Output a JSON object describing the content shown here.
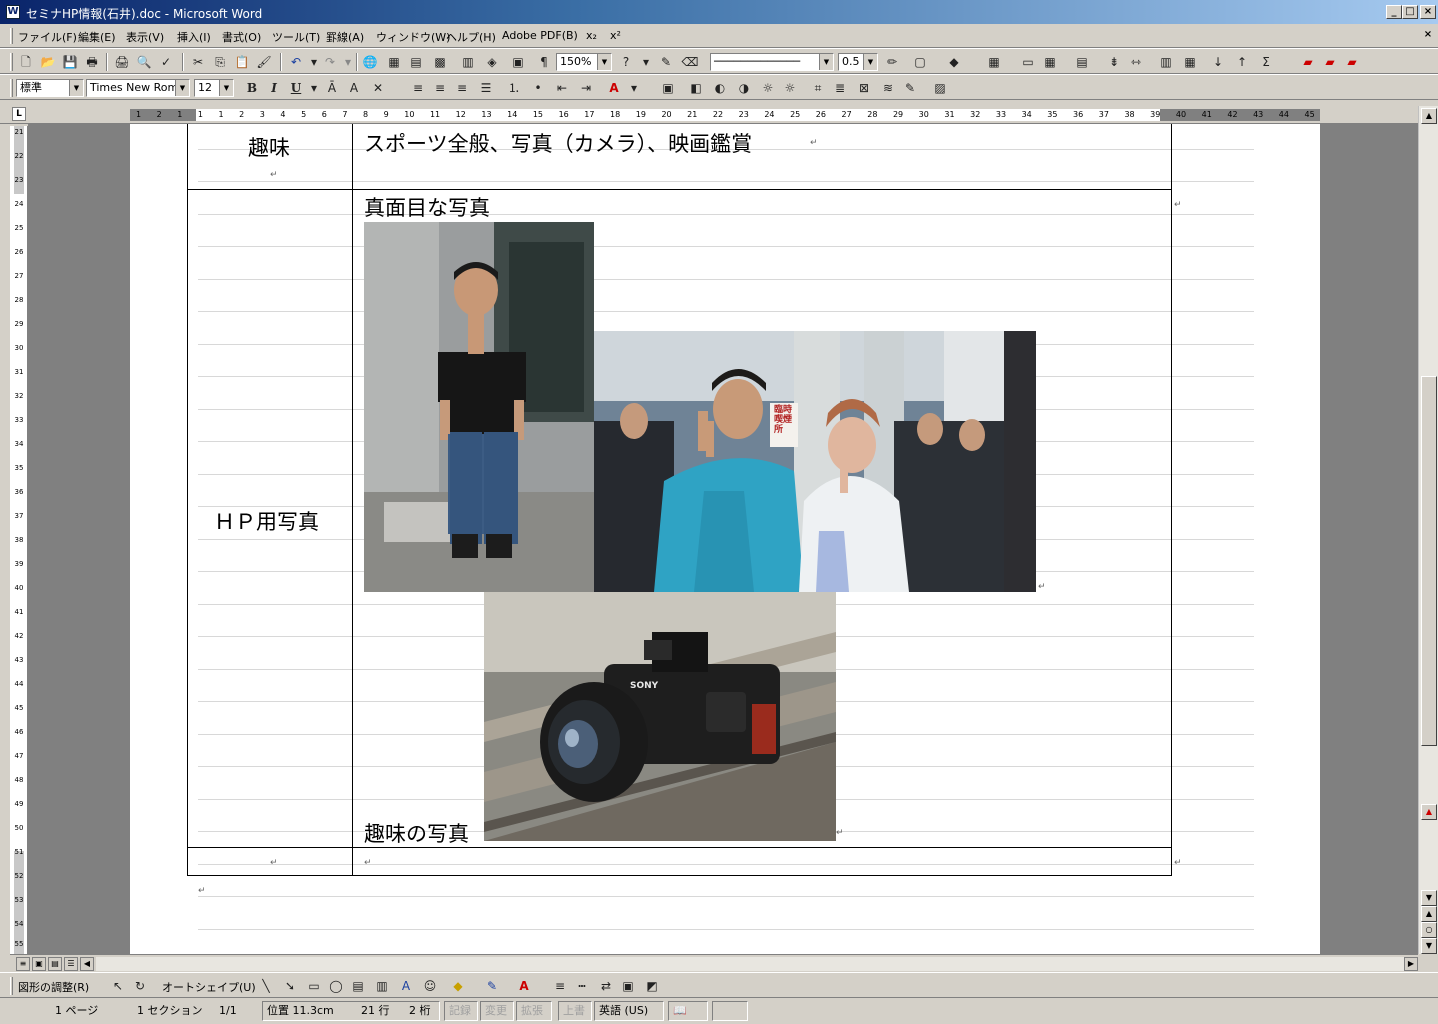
{
  "window": {
    "title": "セミナHP情報(石井).doc - Microsoft Word",
    "app_icon": "W",
    "minimize": "_",
    "maximize": "□",
    "close": "×"
  },
  "menu": [
    "ファイル(F)",
    "編集(E)",
    "表示(V)",
    "挿入(I)",
    "書式(O)",
    "ツール(T)",
    "罫線(A)",
    "ウィンドウ(W)",
    "ヘルプ(H)",
    "Adobe PDF(B)",
    "x₂",
    "x²"
  ],
  "doc_close": "×",
  "toolbar": {
    "zoom": "150%",
    "line_weight": "0.5",
    "style": "標準",
    "font": "Times New Roman",
    "font_size": "12"
  },
  "ruler_numbers": "1 2 1 1 1 2 3 4 5 6 7 8 9 10 11 12 13 14 15 16 17 18 19 20 21 22 23 24 25 26 27 28 29 30 31 32 33 34 35 36 37 38 39 40 41 42 43 44 45 46",
  "vruler_numbers": [
    "21",
    "22",
    "23",
    "24",
    "25",
    "26",
    "27",
    "28",
    "29",
    "30",
    "31",
    "32",
    "33",
    "34",
    "35",
    "36",
    "37",
    "38",
    "39",
    "40",
    "41",
    "42",
    "43",
    "44",
    "45",
    "46",
    "47",
    "48",
    "49",
    "50",
    "51",
    "52",
    "53",
    "54",
    "55"
  ],
  "document": {
    "hobby_label": "趣味",
    "hobby_value": "スポーツ全般、写真（カメラ）、映画鑑賞",
    "serious_photo_caption": "真面目な写真",
    "hp_photo_label": "ＨＰ用写真",
    "hobby_photo_caption": "趣味の写真",
    "para_mark": "↵",
    "camera_brand": "SONY",
    "sign_text": "臨時喫煙所"
  },
  "drawing_toolbar": {
    "adjust": "図形の調整(R)",
    "autoshape": "オートシェイプ(U)"
  },
  "status": {
    "page": "1 ページ",
    "section": "1 セクション",
    "page_of": "1/1",
    "position": "位置 11.3cm",
    "line": "21 行",
    "column": "2 桁",
    "rec": "記録",
    "trk": "変更",
    "ext": "拡張",
    "ovr": "上書",
    "language": "英語 (US)"
  },
  "colors": {
    "title_start": "#0a246a",
    "title_end": "#a6caf0",
    "chrome": "#d4d0c8",
    "workspace": "#808080"
  }
}
